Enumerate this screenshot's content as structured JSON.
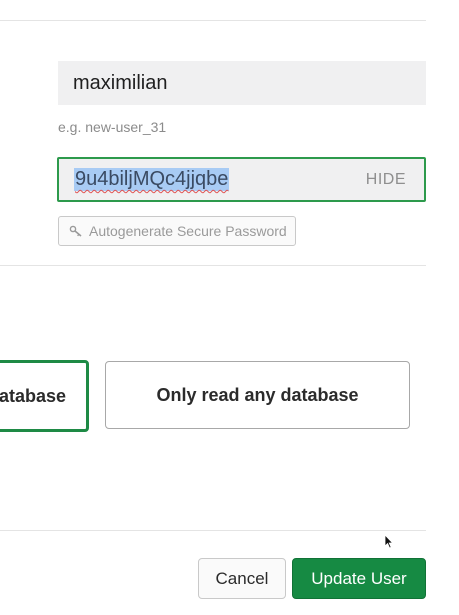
{
  "form": {
    "username_value": "maximilian",
    "username_hint": "e.g. new-user_31",
    "password_value": "9u4biljMQc4jjqbe",
    "password_toggle_label": "HIDE",
    "autogenerate_label": "Autogenerate Secure Password"
  },
  "roles": {
    "selected_card_label": "atabase",
    "readonly_card_label": "Only read any database"
  },
  "footer": {
    "cancel_label": "Cancel",
    "update_label": "Update User"
  },
  "colors": {
    "accent_green": "#168a43",
    "focus_border": "#2d9a4c",
    "selection_highlight": "#a8cbf4"
  },
  "icons": {
    "autogenerate": "key-icon",
    "pointer": "mouse-cursor-icon"
  }
}
